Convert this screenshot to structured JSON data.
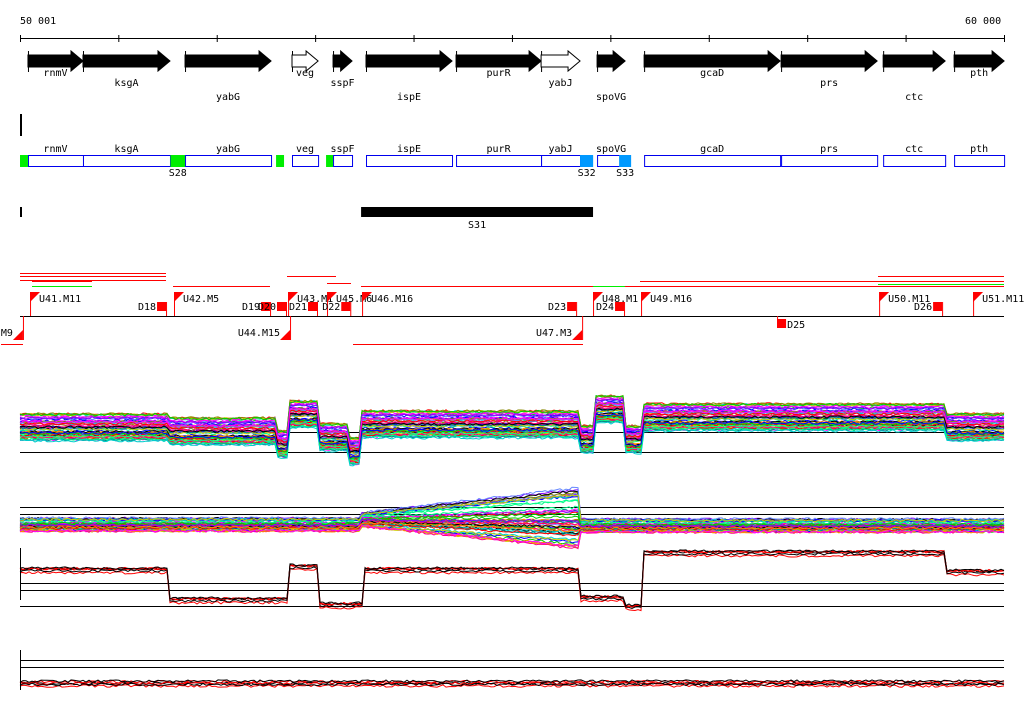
{
  "ruler": {
    "start_label": "50 001",
    "end_label": "60 000",
    "start": 50001,
    "end": 60000,
    "tick_step": 1000
  },
  "genes": [
    {
      "name": "rnmV",
      "start": 50082,
      "end": 50641,
      "filled": true,
      "row": 0
    },
    {
      "name": "ksgA",
      "start": 50641,
      "end": 51525,
      "filled": true,
      "row": 1
    },
    {
      "name": "yabG",
      "start": 51678,
      "end": 52552,
      "filled": true,
      "row": 2
    },
    {
      "name": "veg",
      "start": 52765,
      "end": 53030,
      "filled": false,
      "row": 0
    },
    {
      "name": "sspF",
      "start": 53182,
      "end": 53375,
      "filled": true,
      "row": 1
    },
    {
      "name": "ispE",
      "start": 53517,
      "end": 54391,
      "filled": true,
      "row": 2
    },
    {
      "name": "purR",
      "start": 54432,
      "end": 55296,
      "filled": true,
      "row": 0
    },
    {
      "name": "yabJ",
      "start": 55296,
      "end": 55692,
      "filled": false,
      "row": 1
    },
    {
      "name": "spoVG",
      "start": 55865,
      "end": 56150,
      "filled": true,
      "row": 2
    },
    {
      "name": "gcaD",
      "start": 56343,
      "end": 57725,
      "filled": true,
      "row": 0
    },
    {
      "name": "prs",
      "start": 57735,
      "end": 58711,
      "filled": true,
      "row": 1
    },
    {
      "name": "ctc",
      "start": 58772,
      "end": 59402,
      "filled": true,
      "row": 2
    },
    {
      "name": "pth",
      "start": 59493,
      "end": 60001,
      "filled": true,
      "row": 0
    }
  ],
  "signals": [
    {
      "label": "",
      "start": 50001,
      "end": 50082,
      "color": "#00ee00"
    },
    {
      "label": "S28",
      "start": 51530,
      "end": 51678,
      "color": "#00ee00"
    },
    {
      "label": "",
      "start": 52603,
      "end": 52684,
      "color": "#00ee00"
    },
    {
      "label": "",
      "start": 53111,
      "end": 53182,
      "color": "#00ee00"
    },
    {
      "label": "S32",
      "start": 55692,
      "end": 55825,
      "color": "#0099ff"
    },
    {
      "label": "S33",
      "start": 56089,
      "end": 56211,
      "color": "#0099ff"
    }
  ],
  "segments": [
    {
      "label": "S31",
      "start": 53467,
      "end": 55824
    }
  ],
  "up_flags": [
    {
      "label": "U41.M11",
      "pos": 50103
    },
    {
      "label": "U42.M5",
      "pos": 51566
    },
    {
      "label": "U43.M1",
      "pos": 52725
    },
    {
      "label": "U45.M6",
      "pos": 53121
    },
    {
      "label": "U46.M16",
      "pos": 53477
    },
    {
      "label": "U48.M1",
      "pos": 55824
    },
    {
      "label": "U49.M16",
      "pos": 56312
    },
    {
      "label": "U50.M11",
      "pos": 58731
    },
    {
      "label": "U51.M11",
      "pos": 59686
    }
  ],
  "down_flags": [
    {
      "label": "M9",
      "pos": 50031
    },
    {
      "label": "U44.M15",
      "pos": 52745
    },
    {
      "label": "U47.M3",
      "pos": 55713
    }
  ],
  "breaks_up": [
    {
      "label": "D18",
      "pos": 51485
    },
    {
      "label": "D19",
      "pos": 52542
    },
    {
      "label": "D20",
      "pos": 52704
    },
    {
      "label": "D21",
      "pos": 53019
    },
    {
      "label": "D22",
      "pos": 53357
    },
    {
      "label": "D23",
      "pos": 55652
    },
    {
      "label": "D24",
      "pos": 56139
    },
    {
      "label": "D26",
      "pos": 59371
    }
  ],
  "breaks_down": [
    {
      "label": "D25",
      "pos": 57694
    }
  ],
  "colors": {
    "gene_box": "#0000ee",
    "feature": "#ff0000",
    "green": "#00ee00"
  }
}
